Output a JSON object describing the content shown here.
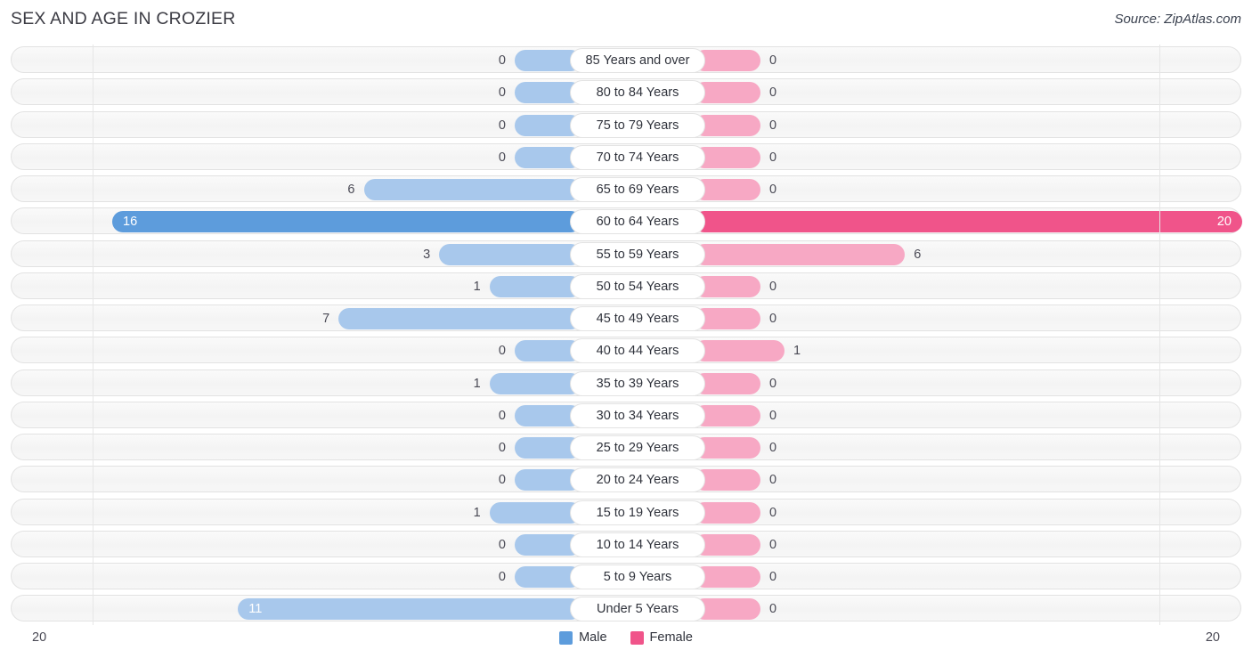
{
  "header": {
    "title": "SEX AND AGE IN CROZIER",
    "source": "Source: ZipAtlas.com"
  },
  "legend": {
    "male": {
      "label": "Male",
      "color": "#5d9cdc"
    },
    "female": {
      "label": "Female",
      "color": "#f0548a"
    }
  },
  "axis": {
    "left_label": "20",
    "right_label": "20"
  },
  "colors": {
    "male_light": "#a8c8ec",
    "male_strong": "#5d9cdc",
    "female_light": "#f7a8c4",
    "female_strong": "#f0548a",
    "row_track": "#f6f6f6",
    "row_border": "#e2e2e2",
    "text": "#4a4a55"
  },
  "chart_data": {
    "type": "bar",
    "title": "SEX AND AGE IN CROZIER",
    "subtype": "population-pyramid",
    "xlabel": "",
    "ylabel": "",
    "xlim": [
      20,
      20
    ],
    "grid": false,
    "legend_position": "bottom-center",
    "categories": [
      "85 Years and over",
      "80 to 84 Years",
      "75 to 79 Years",
      "70 to 74 Years",
      "65 to 69 Years",
      "60 to 64 Years",
      "55 to 59 Years",
      "50 to 54 Years",
      "45 to 49 Years",
      "40 to 44 Years",
      "35 to 39 Years",
      "30 to 34 Years",
      "25 to 29 Years",
      "20 to 24 Years",
      "15 to 19 Years",
      "10 to 14 Years",
      "5 to 9 Years",
      "Under 5 Years"
    ],
    "series": [
      {
        "name": "Male",
        "color": "#5d9cdc",
        "values": [
          0,
          0,
          0,
          0,
          6,
          16,
          3,
          1,
          7,
          0,
          1,
          0,
          0,
          0,
          1,
          0,
          0,
          11
        ]
      },
      {
        "name": "Female",
        "color": "#f0548a",
        "values": [
          0,
          0,
          0,
          0,
          0,
          20,
          6,
          0,
          0,
          1,
          0,
          0,
          0,
          0,
          0,
          0,
          0,
          0
        ]
      }
    ]
  },
  "rows": [
    {
      "label": "85 Years and over",
      "male": "0",
      "female": "0"
    },
    {
      "label": "80 to 84 Years",
      "male": "0",
      "female": "0"
    },
    {
      "label": "75 to 79 Years",
      "male": "0",
      "female": "0"
    },
    {
      "label": "70 to 74 Years",
      "male": "0",
      "female": "0"
    },
    {
      "label": "65 to 69 Years",
      "male": "6",
      "female": "0"
    },
    {
      "label": "60 to 64 Years",
      "male": "16",
      "female": "20"
    },
    {
      "label": "55 to 59 Years",
      "male": "3",
      "female": "6"
    },
    {
      "label": "50 to 54 Years",
      "male": "1",
      "female": "0"
    },
    {
      "label": "45 to 49 Years",
      "male": "7",
      "female": "0"
    },
    {
      "label": "40 to 44 Years",
      "male": "0",
      "female": "1"
    },
    {
      "label": "35 to 39 Years",
      "male": "1",
      "female": "0"
    },
    {
      "label": "30 to 34 Years",
      "male": "0",
      "female": "0"
    },
    {
      "label": "25 to 29 Years",
      "male": "0",
      "female": "0"
    },
    {
      "label": "20 to 24 Years",
      "male": "0",
      "female": "0"
    },
    {
      "label": "15 to 19 Years",
      "male": "1",
      "female": "0"
    },
    {
      "label": "10 to 14 Years",
      "male": "0",
      "female": "0"
    },
    {
      "label": "5 to 9 Years",
      "male": "0",
      "female": "0"
    },
    {
      "label": "Under 5 Years",
      "male": "11",
      "female": "0"
    }
  ]
}
